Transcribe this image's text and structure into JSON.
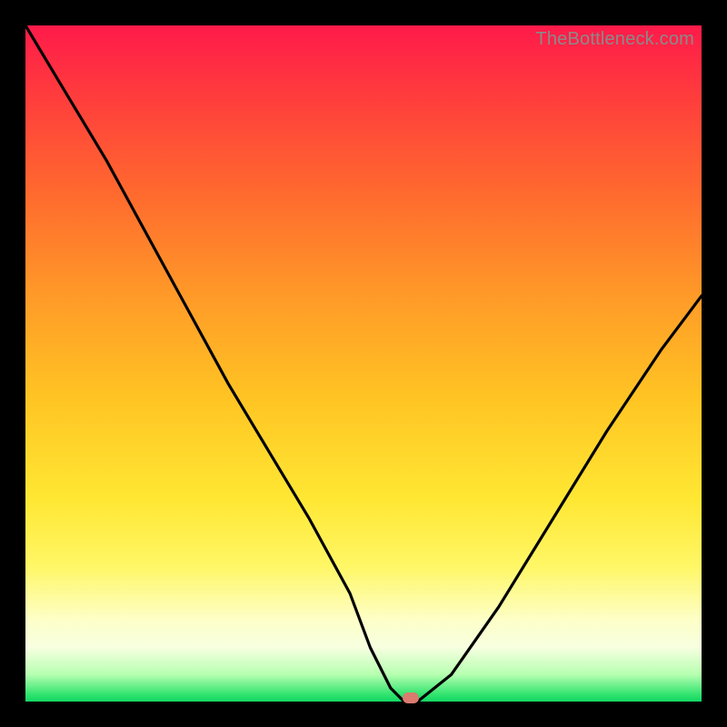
{
  "watermark": "TheBottleneck.com",
  "chart_data": {
    "type": "line",
    "title": "",
    "xlabel": "",
    "ylabel": "",
    "xlim": [
      0,
      100
    ],
    "ylim": [
      0,
      100
    ],
    "series": [
      {
        "name": "bottleneck-curve",
        "x": [
          0,
          6,
          12,
          18,
          24,
          30,
          36,
          42,
          48,
          51,
          54,
          56,
          58,
          63,
          70,
          78,
          86,
          94,
          100
        ],
        "values": [
          100,
          90,
          80,
          69,
          58,
          47,
          37,
          27,
          16,
          8,
          2,
          0,
          0,
          4,
          14,
          27,
          40,
          52,
          60
        ]
      }
    ],
    "marker": {
      "x": 57,
      "y": 0,
      "color": "#d97b6e"
    },
    "background_gradient": {
      "stops": [
        {
          "pos": 0,
          "color": "#ff1a4a"
        },
        {
          "pos": 40,
          "color": "#ff9a28"
        },
        {
          "pos": 70,
          "color": "#ffe733"
        },
        {
          "pos": 92,
          "color": "#f7ffe0"
        },
        {
          "pos": 100,
          "color": "#13d663"
        }
      ]
    }
  }
}
